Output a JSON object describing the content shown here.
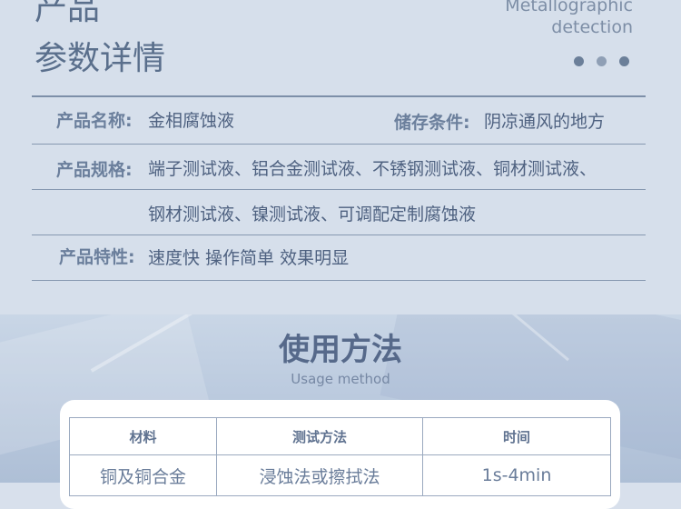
{
  "header": {
    "title_line1": "产品",
    "title_line2": "参数详情",
    "subtitle_line1": "Metallographic",
    "subtitle_line2": "detection"
  },
  "params": {
    "name_label": "产品名称:",
    "name_value": "金相腐蚀液",
    "storage_label": "储存条件:",
    "storage_value": "阴凉通风的地方",
    "spec_label": "产品规格:",
    "spec_line1": "端子测试液、铝合金测试液、不锈钢测试液、铜材测试液、",
    "spec_line2": "钢材测试液、镍测试液、可调配定制腐蚀液",
    "feature_label": "产品特性:",
    "feature_value": "速度快 操作简单 效果明显"
  },
  "usage": {
    "title": "使用方法",
    "subtitle": "Usage method",
    "table": {
      "headers": [
        "材料",
        "测试方法",
        "时间"
      ],
      "rows": [
        [
          "铜及铜合金",
          "浸蚀法或擦拭法",
          "1s-4min"
        ]
      ]
    }
  },
  "colors": {
    "top_bg": "#d6dfeb",
    "text_primary": "#5a6f8c",
    "line": "#8698b0"
  }
}
